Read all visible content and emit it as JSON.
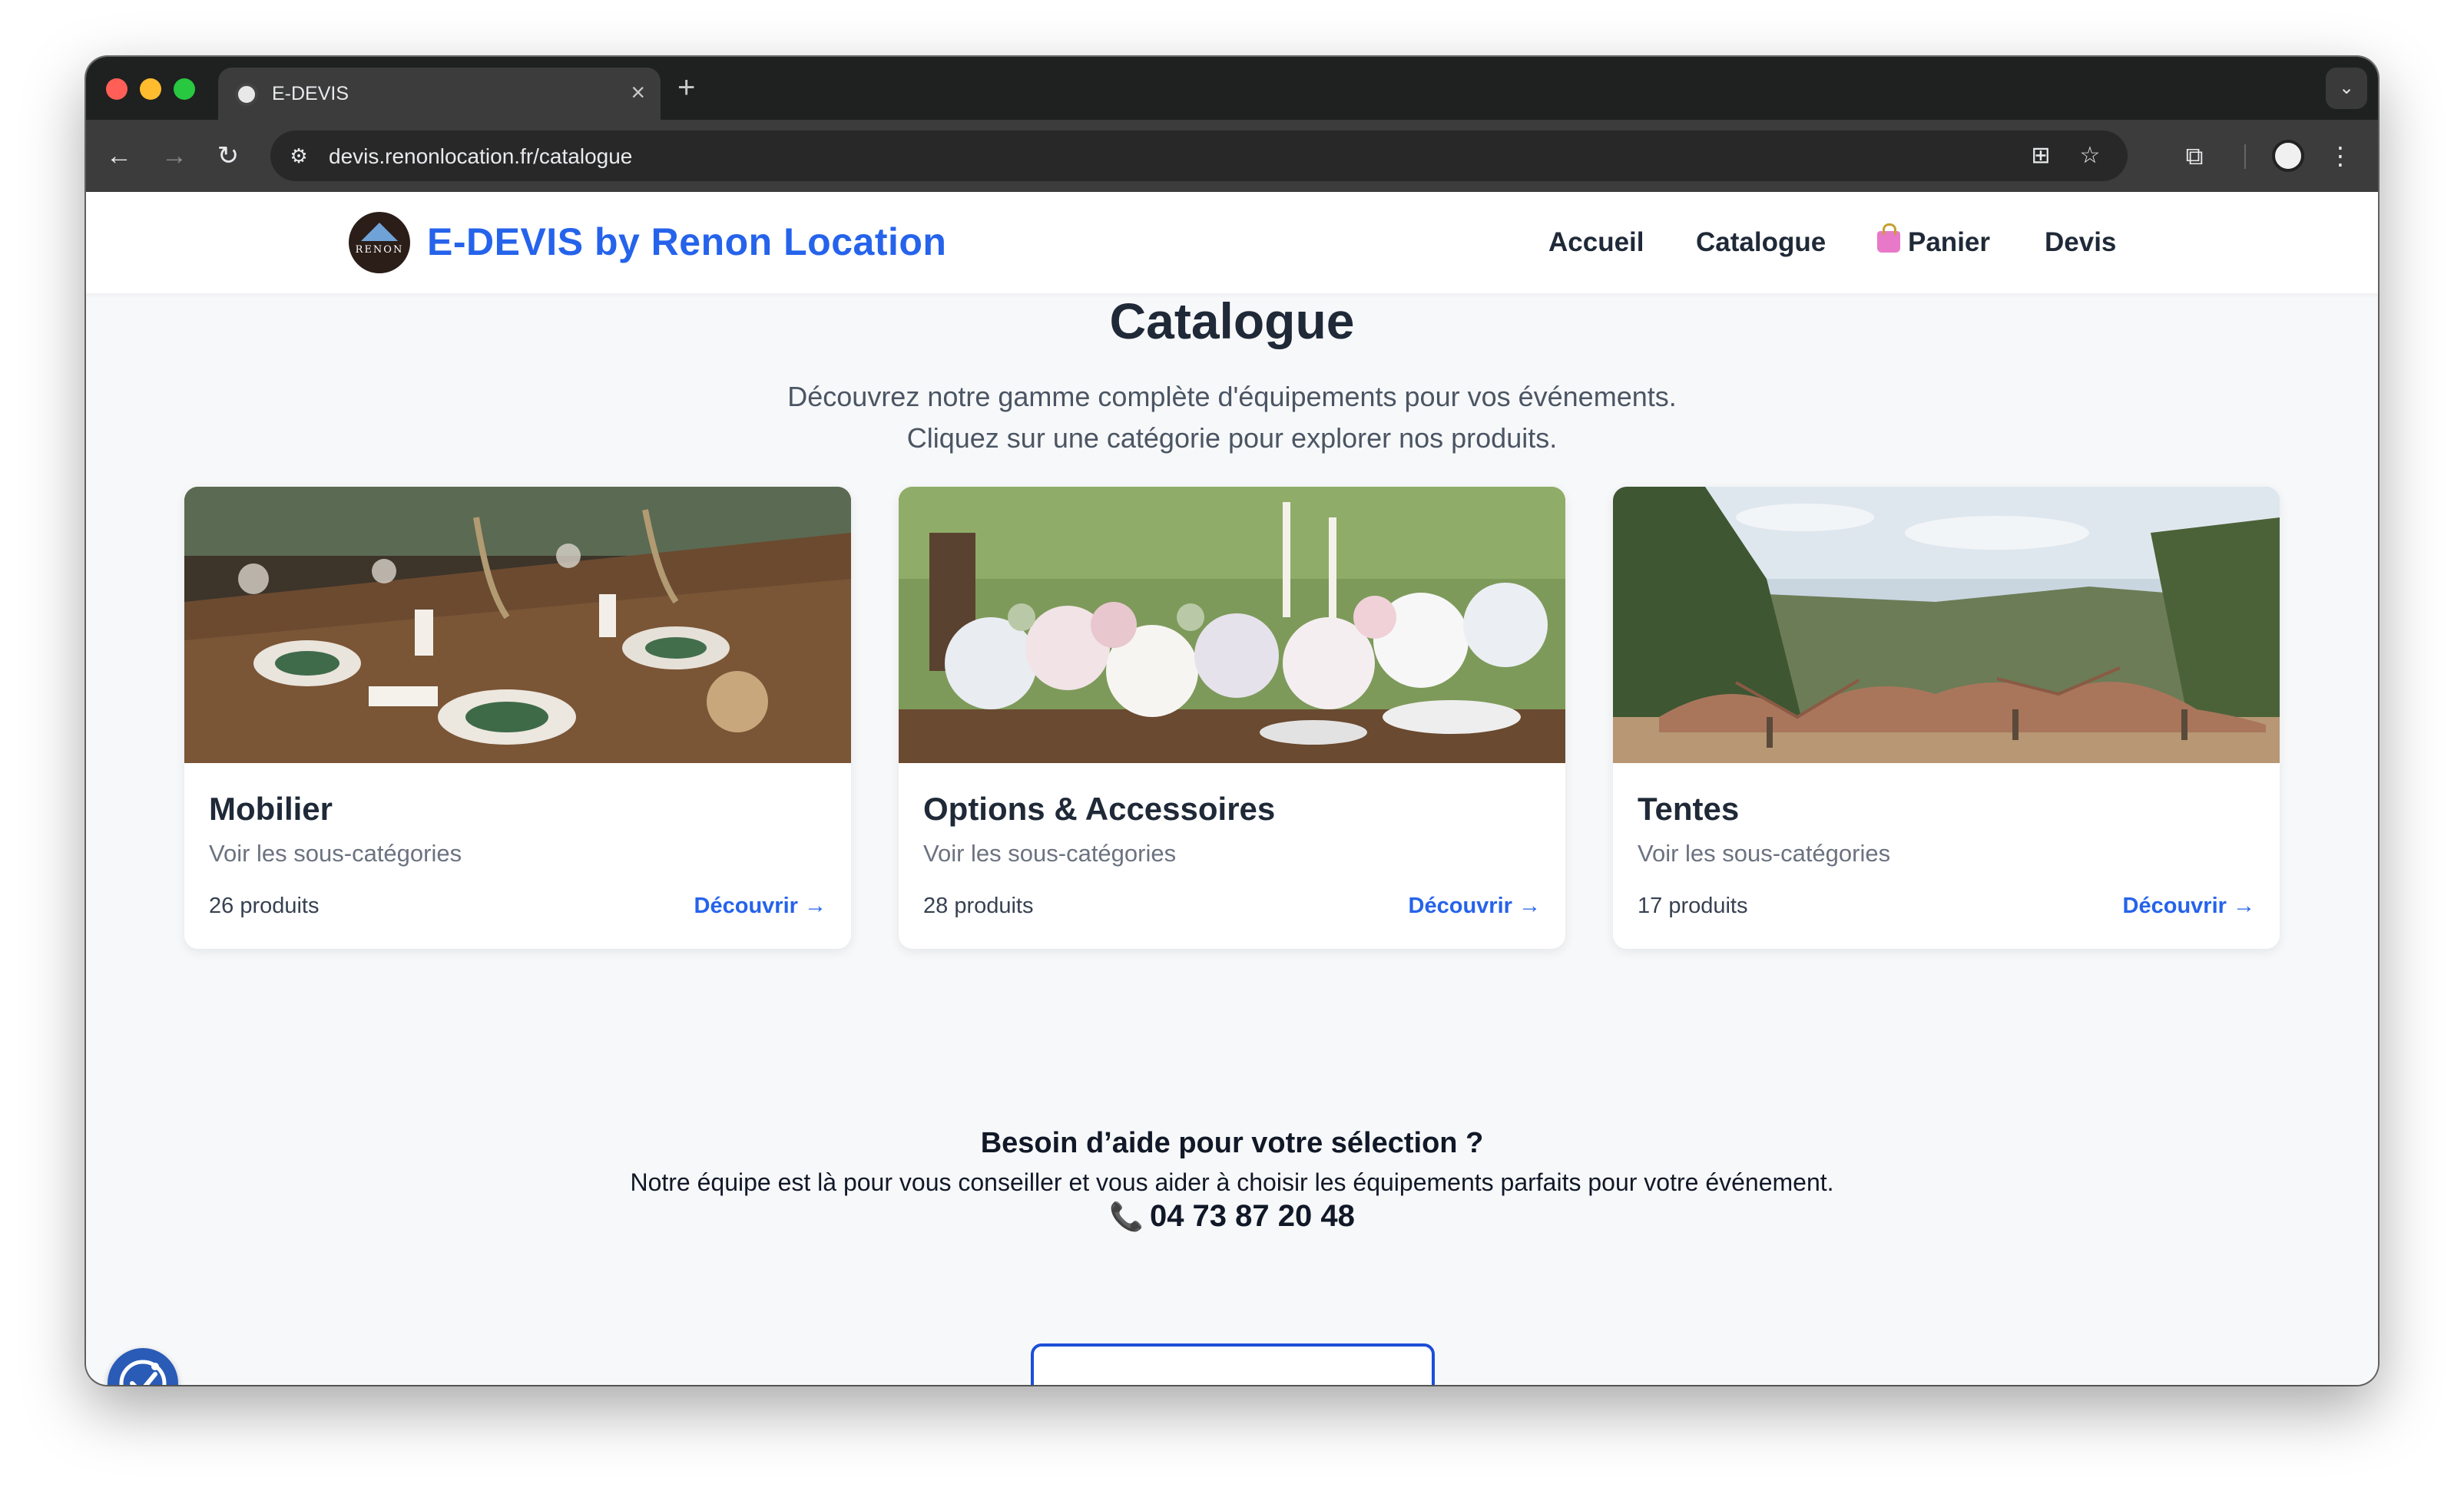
{
  "browser": {
    "tab_title": "E-DEVIS",
    "tab_close": "×",
    "new_tab": "+",
    "tab_menu": "⌄",
    "back": "←",
    "forward": "→",
    "reload": "↻",
    "site_info": "⚙",
    "url": "devis.renonlocation.fr/catalogue",
    "translate": "⊞",
    "bookmark": "☆",
    "extensions": "⧉",
    "menu": "⋮"
  },
  "header": {
    "logo_text": "RENON",
    "brand": "E-DEVIS by Renon Location",
    "nav": {
      "accueil": "Accueil",
      "catalogue": "Catalogue",
      "panier": "Panier",
      "devis": "Devis"
    }
  },
  "hero": {
    "title": "Catalogue",
    "line1": "Découvrez notre gamme complète d'équipements pour vos événements.",
    "line2": "Cliquez sur une catégorie pour explorer nos produits."
  },
  "categories": [
    {
      "title": "Mobilier",
      "subtitle": "Voir les sous-catégories",
      "count": "26 produits",
      "link": "Découvrir →"
    },
    {
      "title": "Options & Accessoires",
      "subtitle": "Voir les sous-catégories",
      "count": "28 produits",
      "link": "Découvrir →"
    },
    {
      "title": "Tentes",
      "subtitle": "Voir les sous-catégories",
      "count": "17 produits",
      "link": "Découvrir →"
    }
  ],
  "help": {
    "title": "Besoin d’aide pour votre sélection ?",
    "text": "Notre équipe est là pour vous conseiller et vous aider à choisir les équipements parfaits pour votre événement.",
    "phone_icon": "📞",
    "phone": "04 73 87 20 48"
  },
  "colors": {
    "brand_blue": "#2563eb",
    "text_dark": "#1f2937",
    "page_bg": "#f7f8fa",
    "accessibility_button": "#2a5bb7"
  }
}
